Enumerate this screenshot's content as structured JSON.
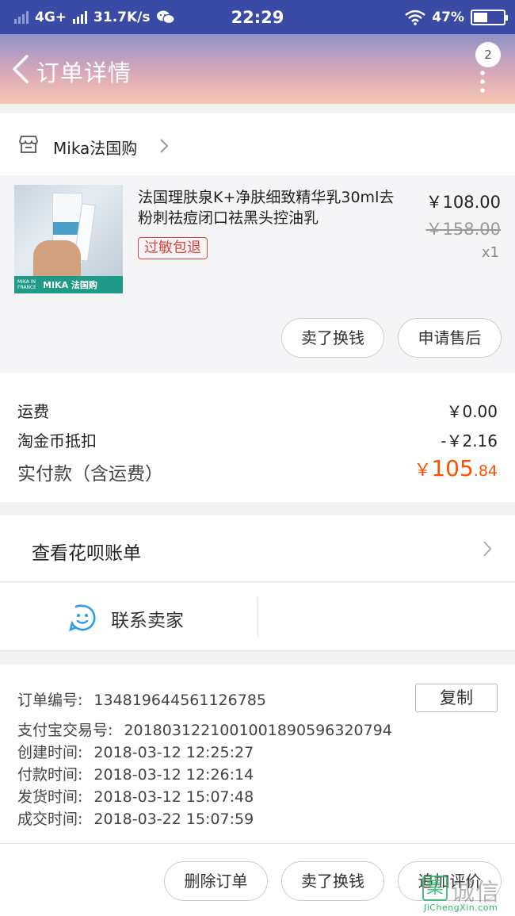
{
  "status_bar": {
    "network": "4G+",
    "speed": "31.7K/s",
    "time": "22:29",
    "battery": "47%",
    "battery_level": 0.47,
    "icons": [
      "signal-icon",
      "signal-icon",
      "wechat-icon",
      "wifi-icon",
      "battery-icon"
    ]
  },
  "header": {
    "title": "订单详情",
    "badge": "2",
    "icons": [
      "back-icon",
      "more-icon"
    ],
    "gradient_colors": [
      "#8f93c9",
      "#f7c7ae"
    ]
  },
  "shop": {
    "name": "Mika法国购",
    "icons": [
      "shop-icon",
      "chevron-right-icon"
    ]
  },
  "product": {
    "title": "法国理肤泉K+净肤细致精华乳30ml去粉刺祛痘闭口祛黑头控油乳",
    "tag": "过敏包退",
    "price": "￥108.00",
    "original_price": "￥158.00",
    "quantity": "x1",
    "image_banner": "MIKA 法国购",
    "image_banner_small": "MIKA IN FRANCE",
    "sell_button": "卖了换钱",
    "after_sale_button": "申请售后"
  },
  "fees": {
    "shipping_label": "运费",
    "shipping_value": "￥0.00",
    "coin_label": "淘金币抵扣",
    "coin_value": "-￥2.16",
    "total_label": "实付款（含运费）",
    "total_currency": "￥",
    "total_integer": "105",
    "total_decimal": ".84",
    "accent_color": "#ff5000"
  },
  "huabei": {
    "label": "查看花呗账单"
  },
  "contact": {
    "label": "联系卖家",
    "icon": "chat-face-icon"
  },
  "order_info": {
    "order_no_label": "订单编号:",
    "order_no": "134819644561126785",
    "copy_button": "复制",
    "alipay_label": "支付宝交易号:",
    "alipay_no": "2018031221001001890596320794",
    "created_label": "创建时间:",
    "created": "2018-03-12 12:25:27",
    "paid_label": "付款时间:",
    "paid": "2018-03-12 12:26:14",
    "shipped_label": "发货时间:",
    "shipped": "2018-03-12 15:07:48",
    "completed_label": "成交时间:",
    "completed": "2018-03-22 15:07:59"
  },
  "bottom_bar": {
    "delete_button": "删除订单",
    "sell_button": "卖了换钱",
    "review_button": "追加评价"
  },
  "watermark": {
    "mark": "集",
    "text": "诚信",
    "sub": "JiChengXin.com"
  }
}
